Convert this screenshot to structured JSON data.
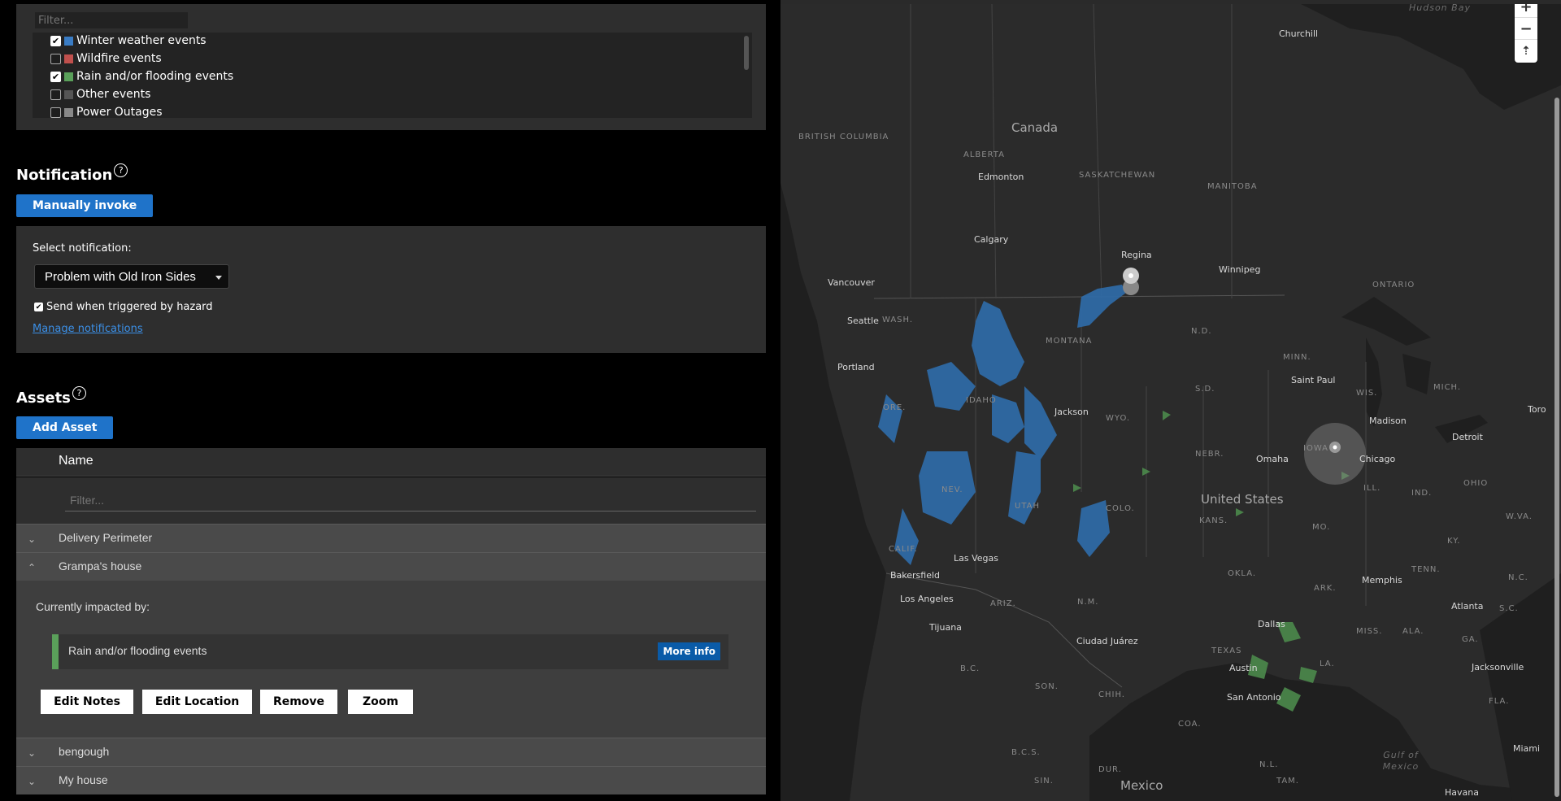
{
  "events": {
    "filter_placeholder": "Filter...",
    "items": [
      {
        "label": "Winter weather events",
        "checked": true,
        "color": "#3a7cc4"
      },
      {
        "label": "Wildfire events",
        "checked": false,
        "color": "#c0504d"
      },
      {
        "label": "Rain and/or flooding events",
        "checked": true,
        "color": "#5aa05a"
      },
      {
        "label": "Other events",
        "checked": false,
        "color": "#555555"
      },
      {
        "label": "Power Outages",
        "checked": false,
        "color": "#888888"
      }
    ]
  },
  "notification": {
    "title": "Notification",
    "help": "?",
    "invoke_button": "Manually invoke",
    "select_label": "Select notification:",
    "selected": "Problem with Old Iron Sides",
    "send_label": "Send when triggered by hazard",
    "send_checked": true,
    "manage_link": "Manage notifications"
  },
  "assets": {
    "title": "Assets",
    "help": "?",
    "add_button": "Add Asset",
    "column_name": "Name",
    "filter_placeholder": "Filter...",
    "rows": [
      "Delivery Perimeter",
      "Grampa's house",
      "bengough",
      "My house"
    ],
    "expanded": {
      "impacted_label": "Currently impacted by:",
      "impact": "Rain and/or flooding events",
      "more_info": "More info",
      "actions": [
        "Edit Notes",
        "Edit Location",
        "Remove",
        "Zoom"
      ]
    }
  },
  "map": {
    "zoom_in": "+",
    "zoom_out": "−",
    "compass": "⇡",
    "labels": {
      "hudson_bay": "Hudson Bay",
      "churchill": "Churchill",
      "canada": "Canada",
      "british_columbia": "BRITISH COLUMBIA",
      "alberta": "ALBERTA",
      "saskatchewan": "SASKATCHEWAN",
      "manitoba": "MANITOBA",
      "ontario": "ONTARIO",
      "edmonton": "Edmonton",
      "calgary": "Calgary",
      "regina": "Regina",
      "winnipeg": "Winnipeg",
      "vancouver": "Vancouver",
      "seattle": "Seattle",
      "wash": "WASH.",
      "montana": "MONTANA",
      "nd": "N.D.",
      "minn": "MINN.",
      "portland": "Portland",
      "ore": "ORE.",
      "idaho": "IDAHO",
      "jackson": "Jackson",
      "wyo": "WYO.",
      "sd": "S.D.",
      "saint_paul": "Saint Paul",
      "wis": "WIS.",
      "mich": "MICH.",
      "madison": "Madison",
      "detroit": "Detroit",
      "toronto": "Toro",
      "nebr": "NEBR.",
      "omaha": "Omaha",
      "iowa": "IOWA",
      "chicago": "Chicago",
      "ill": "ILL.",
      "ind": "IND.",
      "ohio": "OHIO",
      "wva": "W.VA.",
      "nev": "NEV.",
      "utah": "UTAH",
      "colo": "COLO.",
      "united_states": "United States",
      "kans": "KANS.",
      "mo": "MO.",
      "ky": "KY.",
      "calif": "CALIF.",
      "las_vegas": "Las Vegas",
      "bakersfield": "Bakersfield",
      "los_angeles": "Los Angeles",
      "ariz": "ARIZ.",
      "nm": "N.M.",
      "okla": "OKLA.",
      "tenn": "TENN.",
      "nc": "N.C.",
      "memphis": "Memphis",
      "ark": "ARK.",
      "atlanta": "Atlanta",
      "sc": "S.C.",
      "tijuana": "Tijuana",
      "ciudad_juarez": "Ciudad Juárez",
      "dallas": "Dallas",
      "miss": "MISS.",
      "ala": "ALA.",
      "ga": "GA.",
      "texas": "TEXAS",
      "la": "LA.",
      "austin": "Austin",
      "san_antonio": "San Antonio",
      "jacksonville": "Jacksonville",
      "fla": "FLA.",
      "bc": "B.C.",
      "son": "SON.",
      "chih": "CHIH.",
      "coa": "COA.",
      "bcs": "B.C.S.",
      "nl": "N.L.",
      "gulf_of_mexico": "Gulf of Mexico",
      "miami": "Miami",
      "sin": "SIN.",
      "dur": "DUR.",
      "mexico": "Mexico",
      "tam": "TAM.",
      "havana": "Havana"
    }
  }
}
